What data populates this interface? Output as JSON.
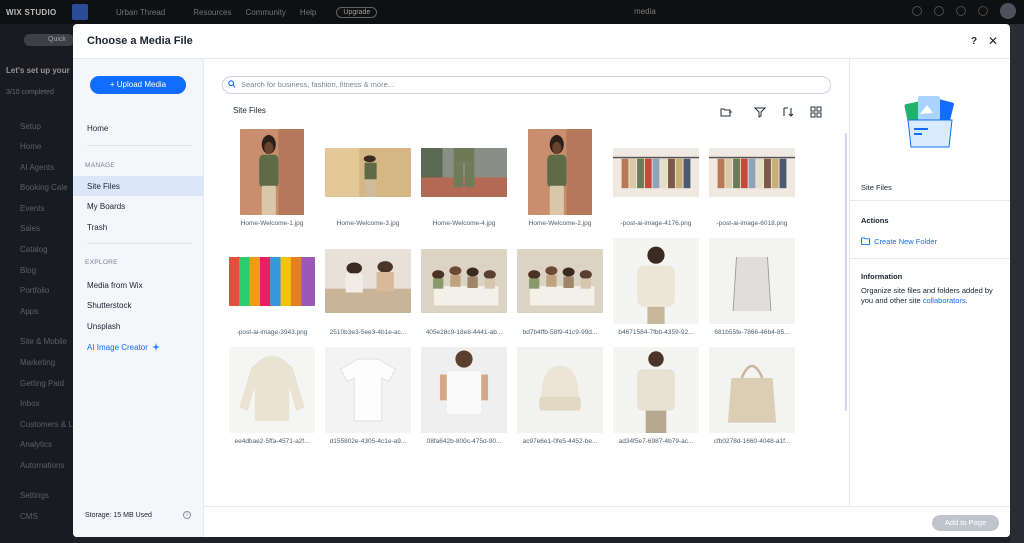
{
  "editor": {
    "logo": "WIX STUDIO",
    "site_name": "Urban Thread",
    "menu": [
      "Resources",
      "Community",
      "Help"
    ],
    "upgrade": "Upgrade",
    "search_value": "media",
    "quick_actions": "Quick",
    "setup_title": "Let's set up your",
    "setup_progress": "3/10 completed",
    "nav_items": [
      "Setup",
      "Home",
      "AI Agents",
      "Booking Cale",
      "Events",
      "Sales",
      "Catalog",
      "Blog",
      "Portfolio",
      "Apps",
      "Site & Mobile",
      "Marketing",
      "Getting Paid",
      "Inbox",
      "Customers & L",
      "Analytics",
      "Automations",
      "Settings",
      "CMS"
    ]
  },
  "modal": {
    "title": "Choose a Media File",
    "help": "?",
    "close": "✕"
  },
  "sidebar": {
    "upload_label": "+ Upload Media",
    "home": "Home",
    "manage_section": "MANAGE",
    "site_files": "Site Files",
    "my_boards": "My Boards",
    "trash": "Trash",
    "explore_section": "EXPLORE",
    "media_from_wix": "Media from Wix",
    "shutterstock": "Shutterstock",
    "unsplash": "Unsplash",
    "ai_creator": "AI Image Creator",
    "storage": "Storage: 15 MB Used"
  },
  "main": {
    "search_placeholder": "Search for business, fashion, fitness & more...",
    "breadcrumb": "Site Files",
    "files": [
      {
        "name": "Home-Welcome-1.jpg",
        "kind": "portrait-sweater"
      },
      {
        "name": "Home-Welcome-3.jpg",
        "kind": "wall-lean"
      },
      {
        "name": "Home-Welcome-4.jpg",
        "kind": "street-pants"
      },
      {
        "name": "Home-Welcome-2.jpg",
        "kind": "portrait-sweater"
      },
      {
        "name": "-post-ai-image-4176.png",
        "kind": "clothes-rack"
      },
      {
        "name": "-post-ai-image-6018.png",
        "kind": "clothes-rack"
      },
      {
        "name": "-post-ai-image-3943.png",
        "kind": "colorful-rack"
      },
      {
        "name": "2510b3e3-5ee3-4b1e-ac...",
        "kind": "workshop"
      },
      {
        "name": "405e28c9-18e8-4441-ab...",
        "kind": "team-table"
      },
      {
        "name": "bd7b4ffb-58f9-41c9-99d...",
        "kind": "team-table"
      },
      {
        "name": "b4671584-7fbb-4359-92...",
        "kind": "hoodie-model"
      },
      {
        "name": "681b55fe-7866-46b4-85...",
        "kind": "drawstring-bag"
      },
      {
        "name": "ee4dbae2-5ffa-4571-a2f...",
        "kind": "hoodie-flat"
      },
      {
        "name": "d155802e-4305-4c1e-a9...",
        "kind": "tshirt-flat"
      },
      {
        "name": "08fa642b-800c-475d-90...",
        "kind": "tshirt-model"
      },
      {
        "name": "ac97e6e1-0fe5-4452-be...",
        "kind": "beanie"
      },
      {
        "name": "ad34f5e7-6987-4b79-ac...",
        "kind": "sweater-model"
      },
      {
        "name": "cfb0278d-1660-4048-a1f...",
        "kind": "tote-bag"
      }
    ]
  },
  "info_panel": {
    "folder_title": "Site Files",
    "actions_heading": "Actions",
    "create_folder": "Create New Folder",
    "information_heading": "Information",
    "information_text": "Organize site files and folders added by you and other site",
    "collaborators_link": "collaborators",
    "period": "."
  },
  "footer": {
    "add_to_page": "Add to Page"
  }
}
